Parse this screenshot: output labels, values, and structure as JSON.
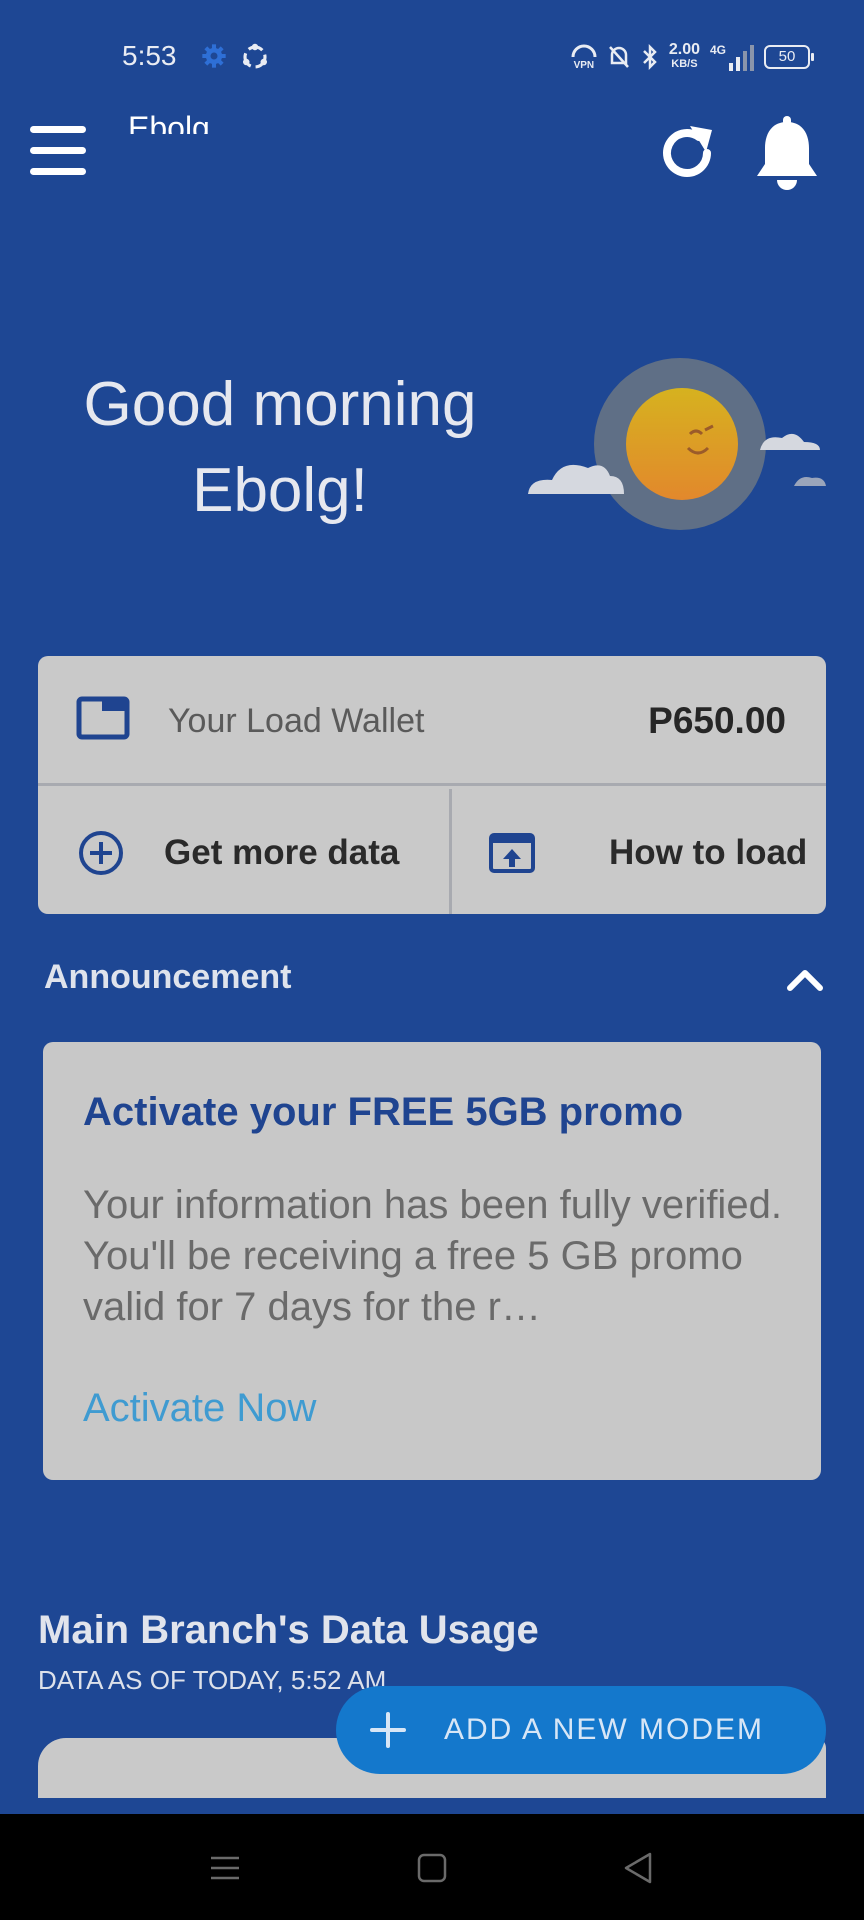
{
  "status_bar": {
    "time": "5:53",
    "vpn": "VPN",
    "speed_value": "2.00",
    "speed_unit": "KB/S",
    "network": "4G",
    "battery": "50"
  },
  "app_bar": {
    "title": "Ebolg",
    "menu_icon": "hamburger-menu-icon",
    "refresh_icon": "refresh-icon",
    "bell_icon": "bell-icon"
  },
  "greeting": {
    "line1": "Good morning",
    "line2": "Ebolg!"
  },
  "wallet": {
    "label": "Your Load Wallet",
    "balance": "P650.00",
    "icon": "wallet-icon"
  },
  "actions": {
    "get_more_data": "Get more data",
    "how_to_load": "How to load"
  },
  "announcement": {
    "heading": "Announcement",
    "title": "Activate your FREE 5GB promo",
    "body": "Your information has been fully verified. You'll be receiving a free 5 GB promo valid for 7 days for the r…",
    "link": "Activate Now"
  },
  "data_usage": {
    "title": "Main Branch's Data Usage",
    "subtitle": "DATA AS OF TODAY, 5:52 AM"
  },
  "fab": {
    "label": "ADD A NEW MODEM"
  },
  "colors": {
    "background": "#1e4794",
    "card": "#c9c9c9",
    "accent_blue": "#1478cc",
    "link": "#3f9bd1",
    "promo_title": "#1f4490"
  }
}
